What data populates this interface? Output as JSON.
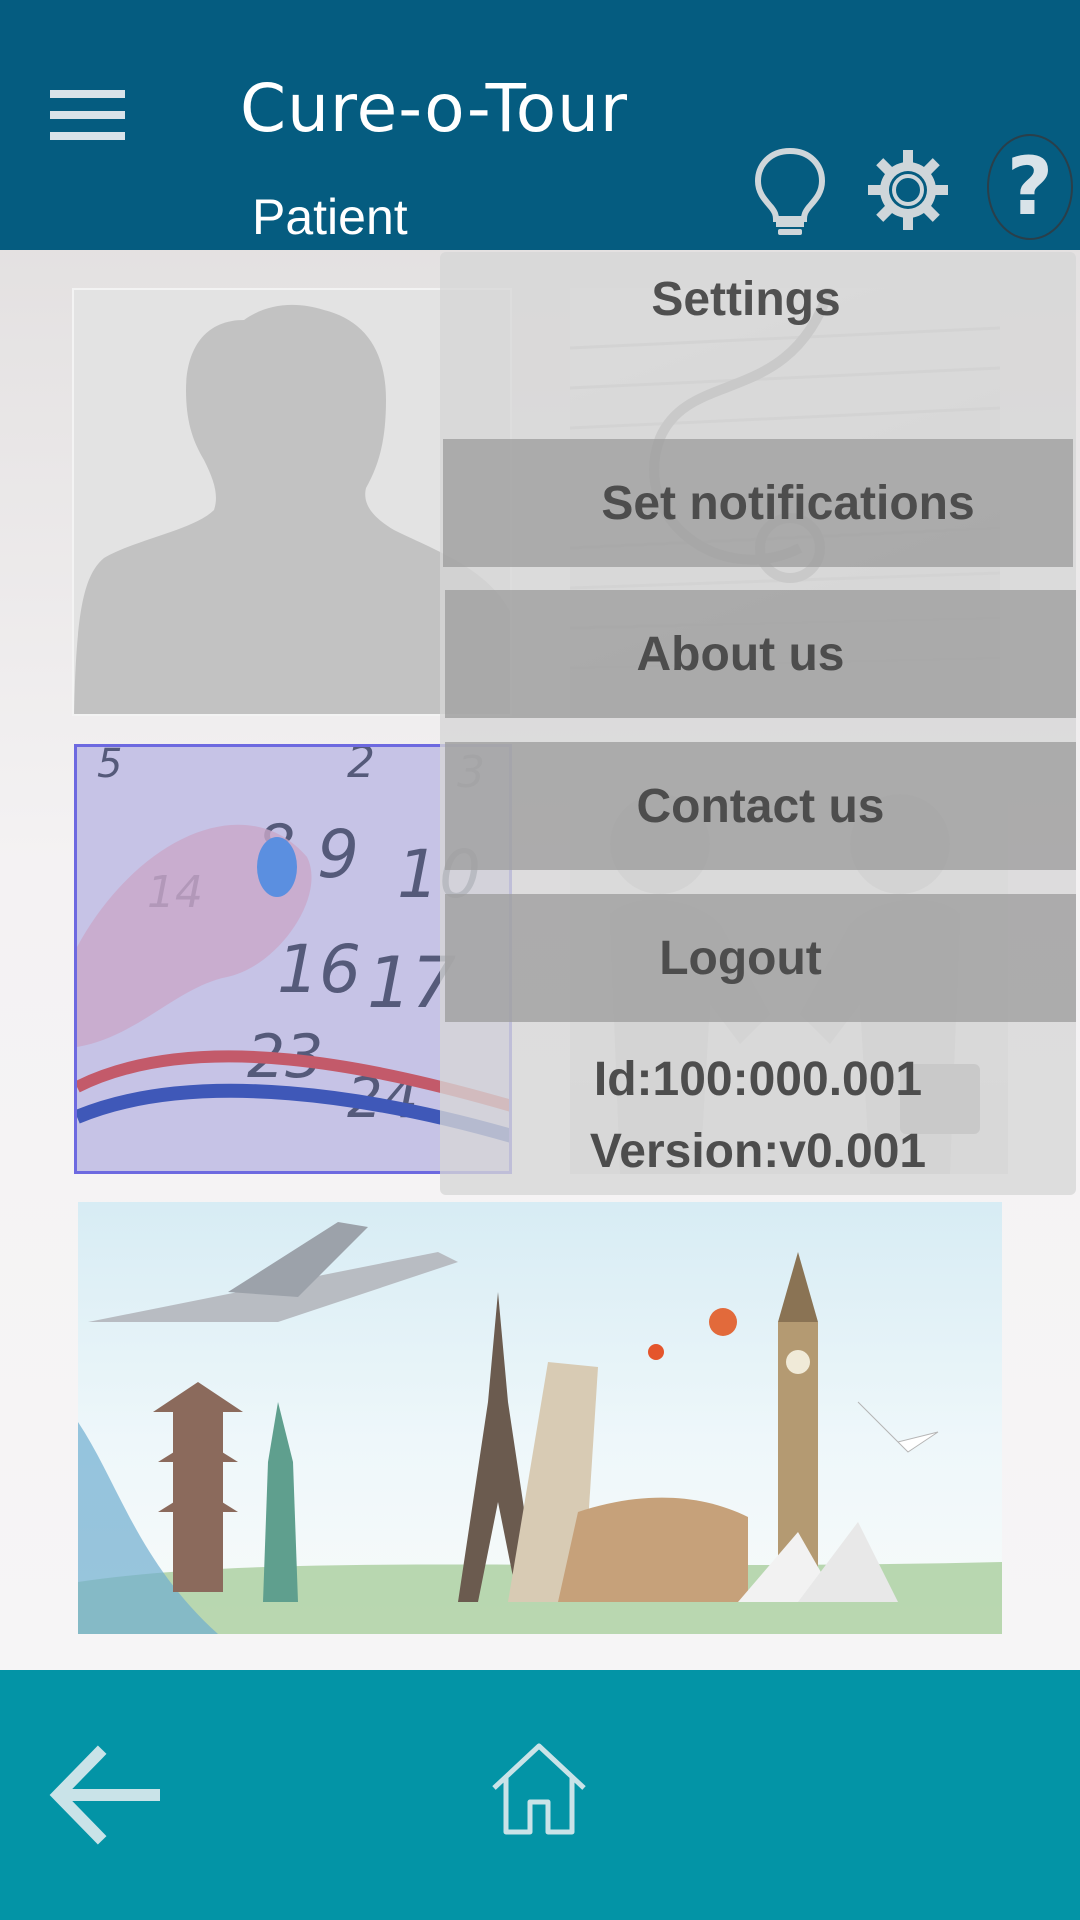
{
  "header": {
    "title": "Cure-o-Tour",
    "subtitle": "Patient",
    "icons": [
      "menu-icon",
      "lightbulb-icon",
      "gear-icon",
      "help-icon"
    ]
  },
  "tiles": [
    {
      "name": "profile",
      "icon": "person-silhouette"
    },
    {
      "name": "medical-records",
      "icon": "stethoscope-papers"
    },
    {
      "name": "appointments",
      "icon": "calendar"
    },
    {
      "name": "consultants",
      "icon": "handshake-figures"
    },
    {
      "name": "travel",
      "icon": "world-landmarks"
    }
  ],
  "settings_menu": {
    "title": "Settings",
    "items": [
      {
        "label": "Set notifications"
      },
      {
        "label": "About us"
      },
      {
        "label": "Contact us"
      },
      {
        "label": "Logout"
      }
    ],
    "id_text": "Id:100:000.001",
    "version_text": "Version:v0.001"
  },
  "bottom_nav": {
    "icons": [
      "back-arrow-icon",
      "home-icon"
    ]
  },
  "colors": {
    "header_bg": "#055c80",
    "bottom_bar_bg": "#0394a6",
    "overlay_bg": "#d6d6d6",
    "menu_item_bg": "#9e9e9e"
  }
}
